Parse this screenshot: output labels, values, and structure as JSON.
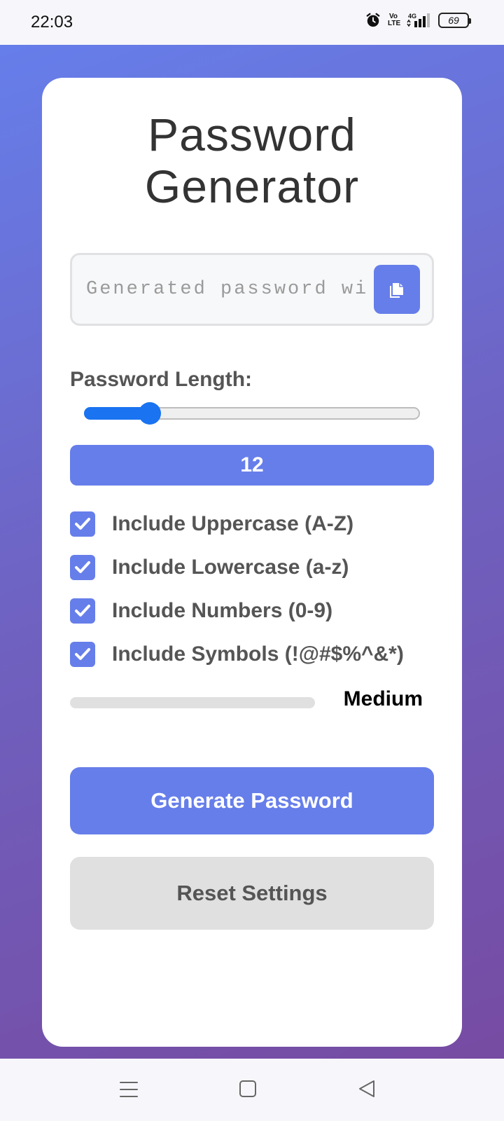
{
  "status_bar": {
    "time": "22:03",
    "volte_top": "Vo",
    "volte_bottom": "LTE",
    "network": "4G",
    "battery": "69"
  },
  "app": {
    "title_line1": "Password",
    "title_line2": "Generator",
    "password_placeholder": "Generated password will appear here",
    "length_label": "Password Length:",
    "length_value": "12",
    "length_min": 4,
    "length_max": 50,
    "options": [
      {
        "label": "Include Uppercase (A-Z)",
        "checked": true
      },
      {
        "label": "Include Lowercase (a-z)",
        "checked": true
      },
      {
        "label": "Include Numbers (0-9)",
        "checked": true
      },
      {
        "label": "Include Symbols (!@#$%^&*)",
        "checked": true
      }
    ],
    "strength_text": "Medium",
    "generate_label": "Generate Password",
    "reset_label": "Reset Settings"
  },
  "colors": {
    "accent": "#667eea",
    "gradient_end": "#764ba2",
    "slider": "#1a73f0"
  },
  "icons": {
    "copy": "copy-icon",
    "check": "check-icon",
    "alarm": "alarm-icon",
    "signal": "signal-icon",
    "nav_menu": "menu-icon",
    "nav_home": "home-icon",
    "nav_back": "back-icon"
  }
}
